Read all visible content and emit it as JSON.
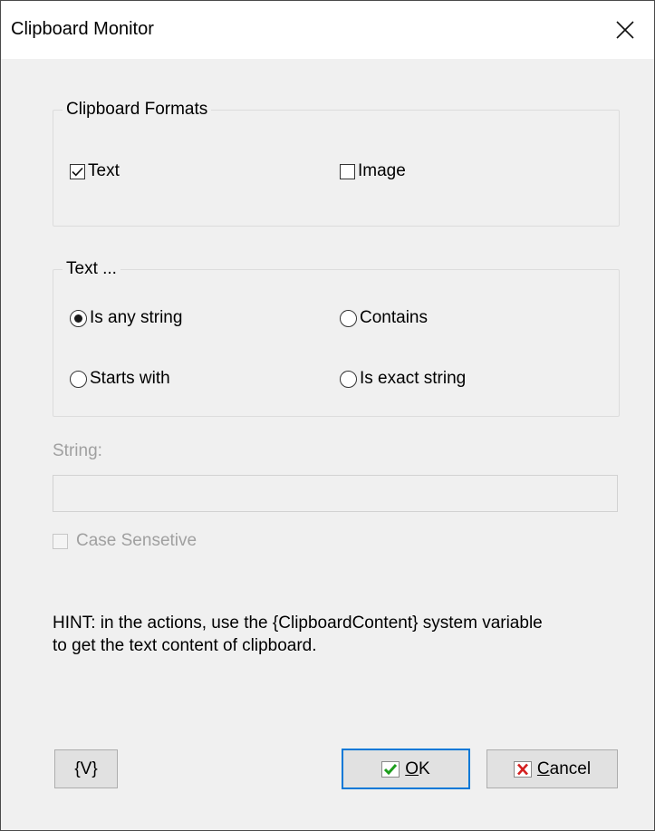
{
  "window": {
    "title": "Clipboard Monitor"
  },
  "formats_group": {
    "legend": "Clipboard Formats",
    "text": {
      "label": "Text",
      "checked": true
    },
    "image": {
      "label": "Image",
      "checked": false
    }
  },
  "text_group": {
    "legend": "Text ...",
    "options": [
      {
        "label": "Is any string",
        "selected": true
      },
      {
        "label": "Contains",
        "selected": false
      },
      {
        "label": "Starts with",
        "selected": false
      },
      {
        "label": "Is exact string",
        "selected": false
      }
    ]
  },
  "string_field": {
    "label": "String:",
    "value": ""
  },
  "case_sensitive": {
    "label": "Case Sensetive",
    "checked": false,
    "enabled": false
  },
  "hint": {
    "line1": "HINT: in the actions, use the {ClipboardContent} system variable",
    "line2": "to get the text content of clipboard."
  },
  "buttons": {
    "variables": "{V}",
    "ok_prefix": "",
    "ok_mnemonic": "O",
    "ok_rest": "K",
    "cancel_mnemonic": "C",
    "cancel_rest": "ancel"
  },
  "icons": {
    "ok": "check-icon",
    "cancel": "x-icon",
    "close": "close-icon"
  },
  "colors": {
    "ok_check": "#1e9e1e",
    "cancel_x": "#d42020",
    "focus_border": "#0078d7"
  }
}
